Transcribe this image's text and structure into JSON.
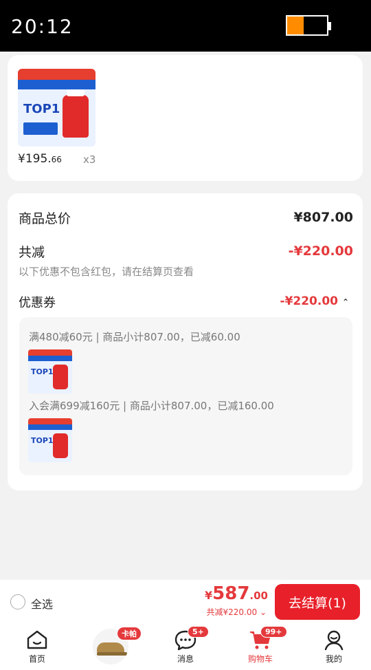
{
  "status_bar": {
    "time": "20:12"
  },
  "product": {
    "price_main": "¥195.",
    "price_decimal": "66",
    "quantity": "x3",
    "image_text": "TOP1"
  },
  "summary": {
    "total_label": "商品总价",
    "total_value": "¥807.00",
    "discount_label": "共减",
    "discount_value": "-¥220.00",
    "note": "以下优惠不包含红包，请在结算页查看",
    "coupon_label": "优惠券",
    "coupon_value": "-¥220.00",
    "coupon_lines": [
      "满480减60元 | 商品小计807.00，已减60.00",
      "入会满699减160元 | 商品小计807.00，已减160.00"
    ]
  },
  "checkout": {
    "select_all": "全选",
    "currency": "¥",
    "total_int": "587",
    "total_dec": ".00",
    "saved": "共减¥220.00",
    "button": "去结算(1)"
  },
  "tabbar": {
    "tabs": [
      {
        "label": "首页"
      },
      {
        "label": "卡帕",
        "badge": "卡帕"
      },
      {
        "label": "消息",
        "badge": "5+"
      },
      {
        "label": "购物车",
        "badge": "99+"
      },
      {
        "label": "我的"
      }
    ]
  },
  "colors": {
    "accent": "#e4393c",
    "button": "#e8202a",
    "battery": "#ff8c00"
  }
}
